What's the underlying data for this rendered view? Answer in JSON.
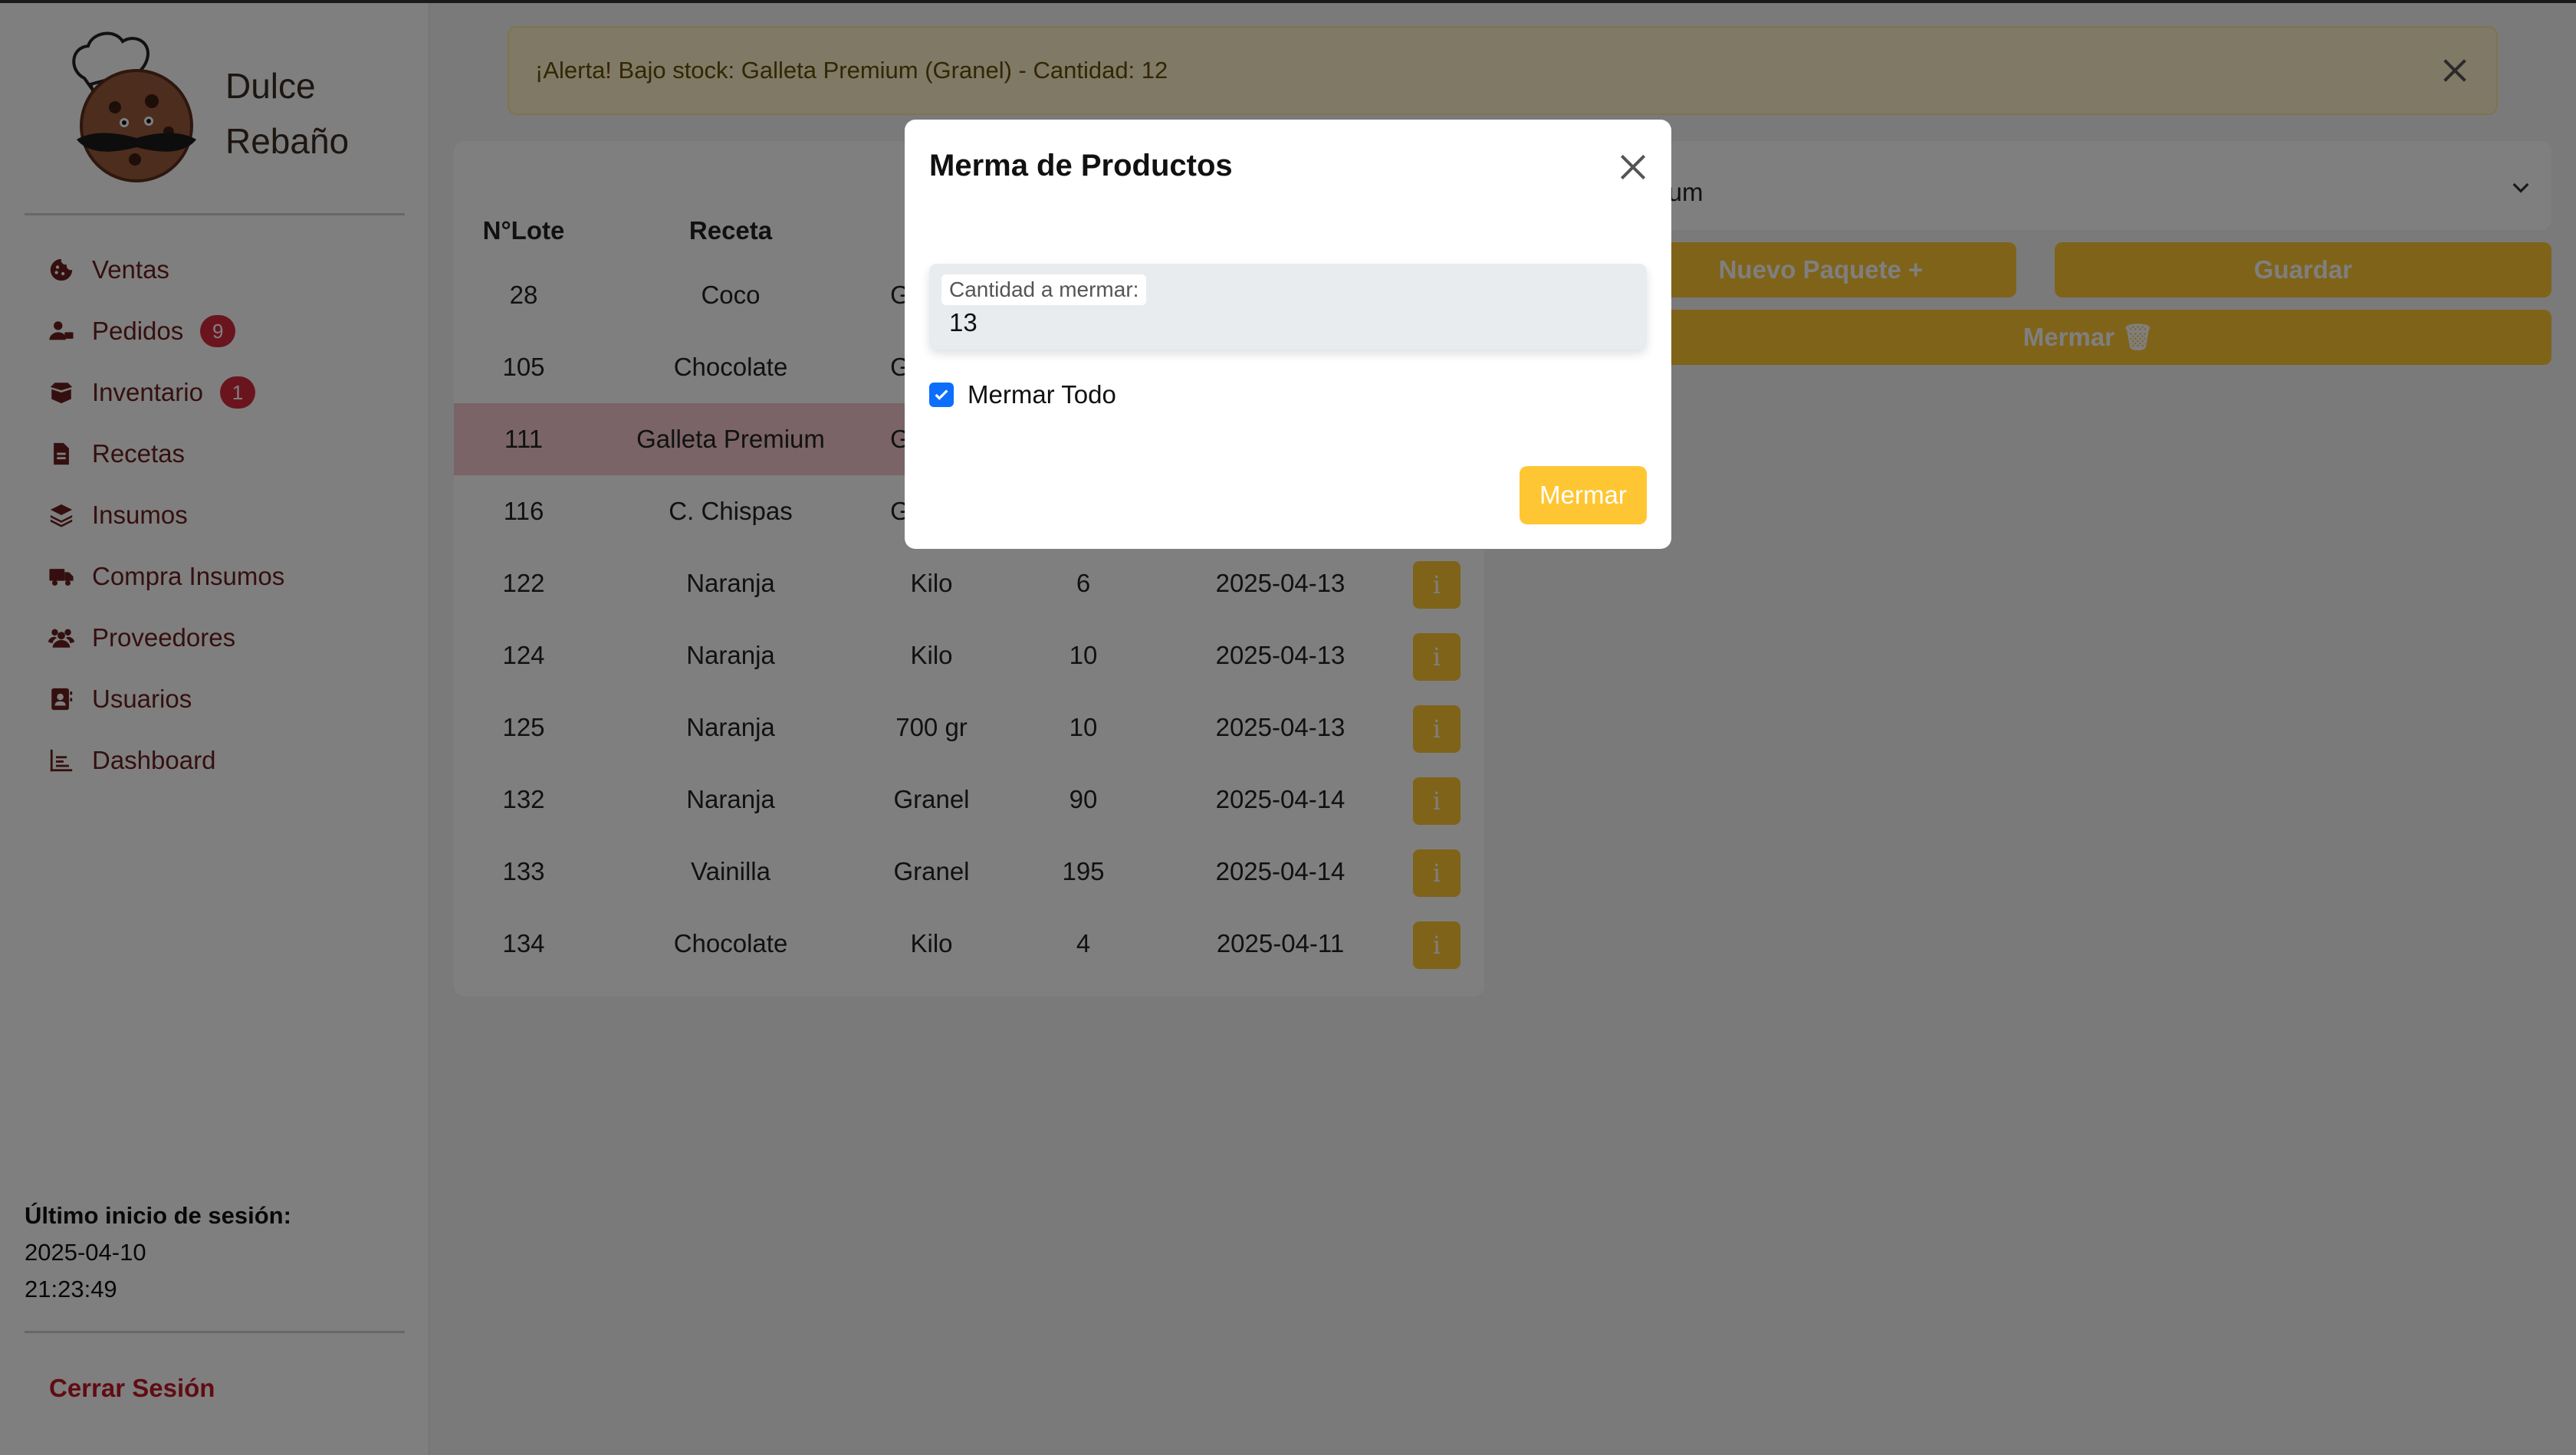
{
  "brand": {
    "line1": "Dulce",
    "line2": "Rebaño"
  },
  "nav": [
    {
      "label": "Ventas",
      "icon": "cookie-icon"
    },
    {
      "label": "Pedidos",
      "icon": "user-truck-icon",
      "badge": "9"
    },
    {
      "label": "Inventario",
      "icon": "box-open-icon",
      "badge": "1"
    },
    {
      "label": "Recetas",
      "icon": "file-icon"
    },
    {
      "label": "Insumos",
      "icon": "layers-icon"
    },
    {
      "label": "Compra Insumos",
      "icon": "truck-icon"
    },
    {
      "label": "Proveedores",
      "icon": "users-icon"
    },
    {
      "label": "Usuarios",
      "icon": "address-book-icon"
    },
    {
      "label": "Dashboard",
      "icon": "chart-icon"
    }
  ],
  "session": {
    "title": "Último inicio de sesión:",
    "date": "2025-04-10",
    "time": "21:23:49"
  },
  "logout": "Cerrar Sesión",
  "alert": {
    "text": "¡Alerta! Bajo stock: Galleta Premium (Granel) - Cantidad: 12"
  },
  "table": {
    "headers": [
      "N°Lote",
      "Receta"
    ],
    "rows": [
      {
        "lote": "28",
        "receta": "Coco",
        "tipo": "G",
        "cantidad": "",
        "fecha": ""
      },
      {
        "lote": "105",
        "receta": "Chocolate",
        "tipo": "G",
        "cantidad": "",
        "fecha": ""
      },
      {
        "lote": "111",
        "receta": "Galleta Premium",
        "tipo": "G",
        "cantidad": "",
        "fecha": "",
        "highlight": true
      },
      {
        "lote": "116",
        "receta": "C. Chispas",
        "tipo": "G",
        "cantidad": "",
        "fecha": ""
      },
      {
        "lote": "122",
        "receta": "Naranja",
        "tipo": "Kilo",
        "cantidad": "6",
        "fecha": "2025-04-13"
      },
      {
        "lote": "124",
        "receta": "Naranja",
        "tipo": "Kilo",
        "cantidad": "10",
        "fecha": "2025-04-13"
      },
      {
        "lote": "125",
        "receta": "Naranja",
        "tipo": "700 gr",
        "cantidad": "10",
        "fecha": "2025-04-13"
      },
      {
        "lote": "132",
        "receta": "Naranja",
        "tipo": "Granel",
        "cantidad": "90",
        "fecha": "2025-04-14"
      },
      {
        "lote": "133",
        "receta": "Vainilla",
        "tipo": "Granel",
        "cantidad": "195",
        "fecha": "2025-04-14"
      },
      {
        "lote": "134",
        "receta": "Chocolate",
        "tipo": "Kilo",
        "cantidad": "4",
        "fecha": "2025-04-11"
      }
    ],
    "info_label": "i"
  },
  "right_panel": {
    "select_value": "nium",
    "nuevo_paquete": "Nuevo Paquete +",
    "guardar": "Guardar",
    "mermar": "Mermar 🗑"
  },
  "modal": {
    "title": "Merma de Productos",
    "field_label": "Cantidad a mermar:",
    "field_value": "13",
    "checkbox_label": "Mermar Todo",
    "checkbox_checked": true,
    "submit": "Mermar"
  },
  "colors": {
    "accent": "#ffc633",
    "brand_text": "#6b1f1f",
    "badge": "#d42a3d",
    "highlight_row": "#f4c8ce",
    "checkbox": "#0d6efd"
  }
}
